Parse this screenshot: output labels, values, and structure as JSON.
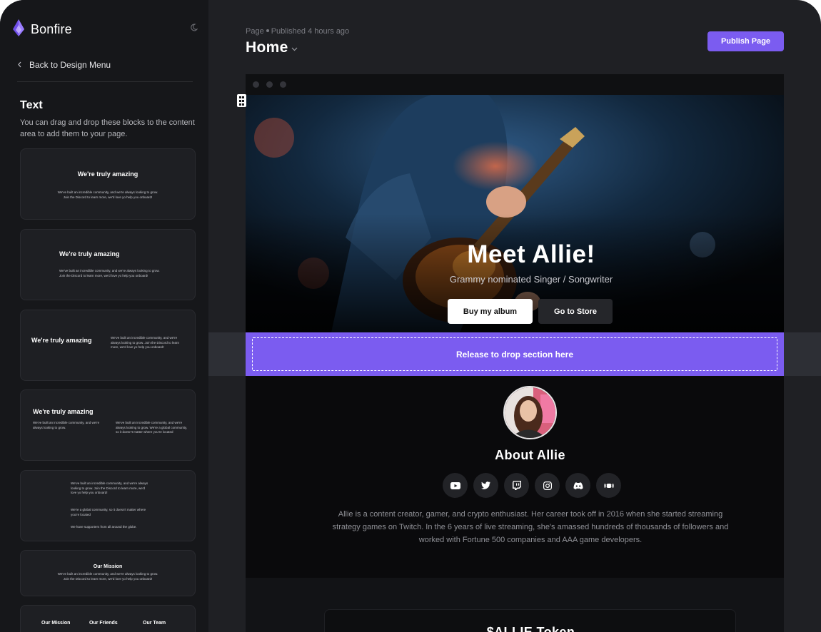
{
  "app": {
    "name": "Bonfire"
  },
  "sidebar": {
    "back_label": "Back to Design Menu",
    "section_title": "Text",
    "section_desc": "You can drag and drop these blocks to the content area to add them to your page.",
    "blocks": [
      {
        "heading": "We're truly amazing",
        "body": "We've built an incredible community, and we're always looking to grow. Join the Discord to learn more, we'd love yo help you onboard!"
      },
      {
        "heading": "We're truly amazing",
        "body": "We've built an incredible community, and we're always looking to grow. Join the Discord to learn more, we'd love yo help you onboard!"
      },
      {
        "heading": "We're truly amazing",
        "body": "We've built an incredible community, and we're always looking to grow. Join the Discord to learn more, we'd love yo help you onboard!"
      },
      {
        "heading": "We're truly amazing",
        "body_left": "We've built an incredible community, and we're always looking to grow.",
        "body_right": "We've built an incredible community, and we're always looking to grow. We're a global community, so it doesn't matter where you're located"
      },
      {
        "p1": "We've built an incredible community, and we're always looking to grow. Join the Discord to learn more, we'd love yo help you onboard!",
        "p2": "We're a global community, so it doesn't matter where you're located",
        "p3": "We have supporters from all around the globe."
      },
      {
        "heading": "Our Mission",
        "body": "We've built an incredible community, and we're always looking to grow. Join the Discord to learn more, we'd love yo help you onboard!"
      },
      {
        "col1": "Our Mission",
        "col2": "Our Friends",
        "col3": "Our Team"
      }
    ]
  },
  "header": {
    "breadcrumb_page": "Page",
    "status": "Published 4 hours ago",
    "title": "Home",
    "publish_label": "Publish Page"
  },
  "hero": {
    "title": "Meet Allie!",
    "subtitle": "Grammy nominated Singer / Songwriter",
    "primary_label": "Buy my album",
    "secondary_label": "Go to Store"
  },
  "drop_zone": {
    "label": "Release to drop section here"
  },
  "about": {
    "title": "About Allie",
    "socials": [
      "youtube-icon",
      "twitter-icon",
      "twitch-icon",
      "instagram-icon",
      "discord-icon",
      "podcast-icon"
    ],
    "body": "Allie is a content creator, gamer, and crypto enthusiast. Her career took off in 2016 when she started streaming strategy games on Twitch. In the 6 years of live streaming, she's amassed hundreds of thousands of followers and worked with Fortune 500 companies and AAA game developers."
  },
  "token": {
    "title": "$ALLIE Token"
  },
  "colors": {
    "accent": "#7b5cf0",
    "sidebar": "#16171a",
    "canvas": "#1f2024"
  }
}
